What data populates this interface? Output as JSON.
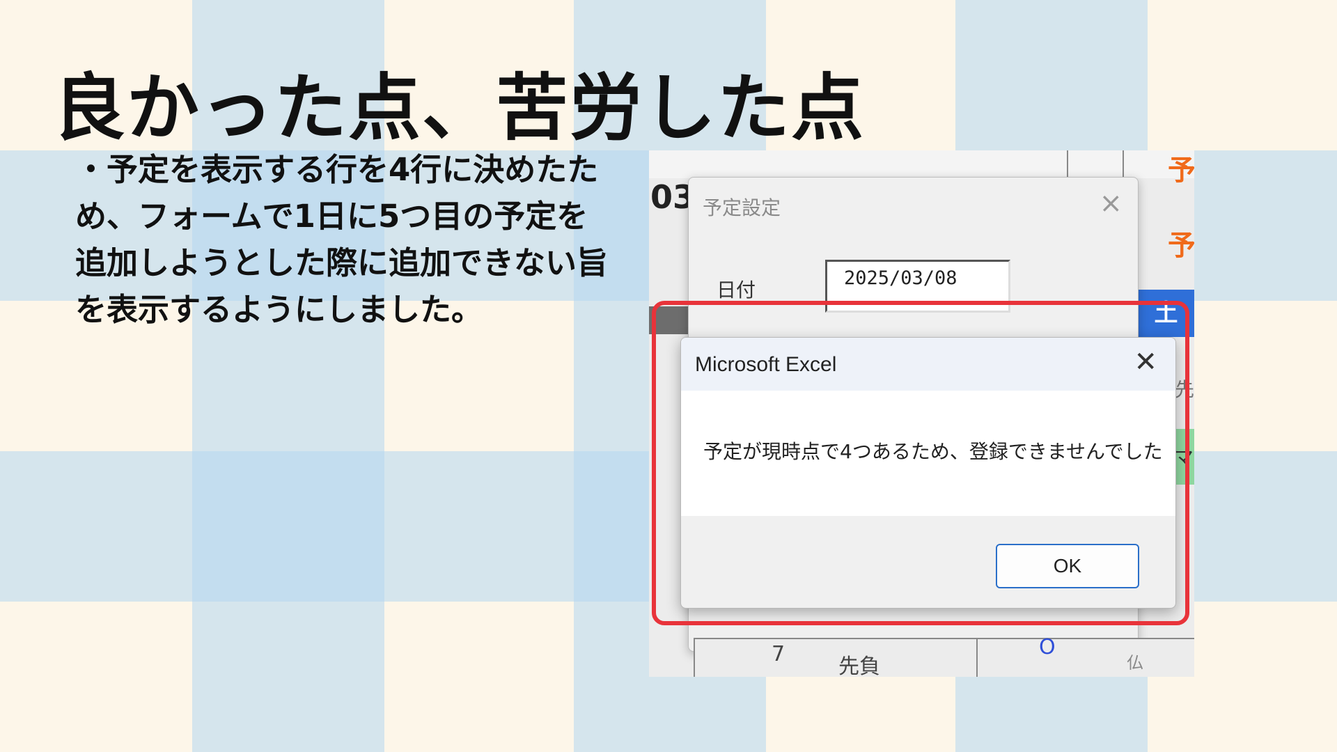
{
  "slide": {
    "title": "良かった点、苦労した点",
    "body": "・予定を表示する行を4行に決めたため、フォームで1日に5つ目の予定を追加しようとした際に追加できない旨を表示するようにしました。"
  },
  "screenshot": {
    "sheet": {
      "cell_number": "03",
      "orange_chars": [
        "予",
        "予"
      ],
      "weekday_cell": "土",
      "side_char_1": "先",
      "side_char_2": "マ",
      "bottom_cells": [
        "7",
        "先負",
        "O",
        "仏"
      ]
    },
    "schedule_dialog": {
      "title": "予定設定",
      "close_icon": "×",
      "date_label": "日付",
      "date_value": "2025/03/08"
    },
    "message_dialog": {
      "title": "Microsoft Excel",
      "close_icon": "✕",
      "message": "予定が現時点で4つあるため、登録できませんでした",
      "ok_label": "OK"
    }
  },
  "colors": {
    "highlight": "#e8333a",
    "ok_border": "#2a6fc9",
    "weekday_blue": "#2f6fd8",
    "accent_orange": "#f06a1a"
  }
}
